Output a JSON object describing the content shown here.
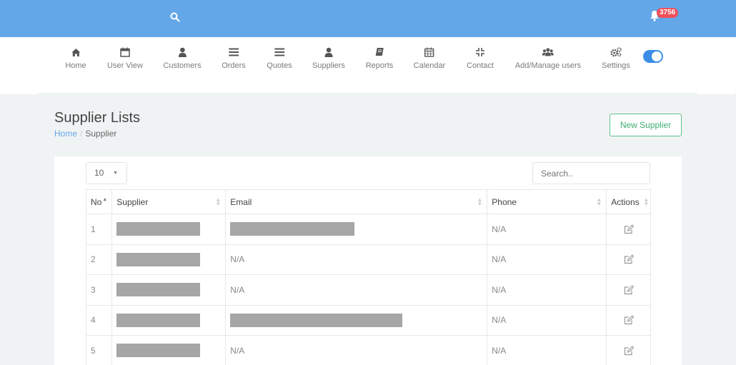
{
  "topbar": {
    "color": "#63a7e8",
    "search_icon": "search-icon",
    "notification_icon": "bell-icon",
    "notification_count": "3756"
  },
  "nav": {
    "items": [
      {
        "label": "Home",
        "icon": "home-icon"
      },
      {
        "label": "User View",
        "icon": "calendar-icon"
      },
      {
        "label": "Customers",
        "icon": "user-icon"
      },
      {
        "label": "Orders",
        "icon": "list-icon"
      },
      {
        "label": "Quotes",
        "icon": "list-icon"
      },
      {
        "label": "Suppliers",
        "icon": "user-icon"
      },
      {
        "label": "Reports",
        "icon": "book-icon"
      },
      {
        "label": "Calendar",
        "icon": "calendar-grid-icon"
      },
      {
        "label": "Contact",
        "icon": "compress-icon"
      },
      {
        "label": "Add/Manage users",
        "icon": "users-icon"
      },
      {
        "label": "Settings",
        "icon": "gears-icon"
      }
    ],
    "toggle_on": true
  },
  "page": {
    "title": "Supplier Lists",
    "breadcrumb_home": "Home",
    "breadcrumb_sep": "/",
    "breadcrumb_current": "Supplier",
    "new_button": "New Supplier"
  },
  "table": {
    "page_length": "10",
    "search_placeholder": "Search..",
    "headers": {
      "no": "No",
      "supplier": "Supplier",
      "email": "Email",
      "phone": "Phone",
      "actions": "Actions"
    },
    "rows": [
      {
        "no": "1",
        "supplier_redacted": true,
        "email": "",
        "email_redacted": true,
        "phone": "N/A"
      },
      {
        "no": "2",
        "supplier_redacted": true,
        "email": "N/A",
        "email_redacted": false,
        "phone": "N/A"
      },
      {
        "no": "3",
        "supplier_redacted": true,
        "email": "N/A",
        "email_redacted": false,
        "phone": "N/A"
      },
      {
        "no": "4",
        "supplier_redacted": true,
        "email": "",
        "email_redacted": true,
        "phone": "N/A"
      },
      {
        "no": "5",
        "supplier_redacted": true,
        "email": "N/A",
        "email_redacted": false,
        "phone": "N/A"
      }
    ]
  }
}
